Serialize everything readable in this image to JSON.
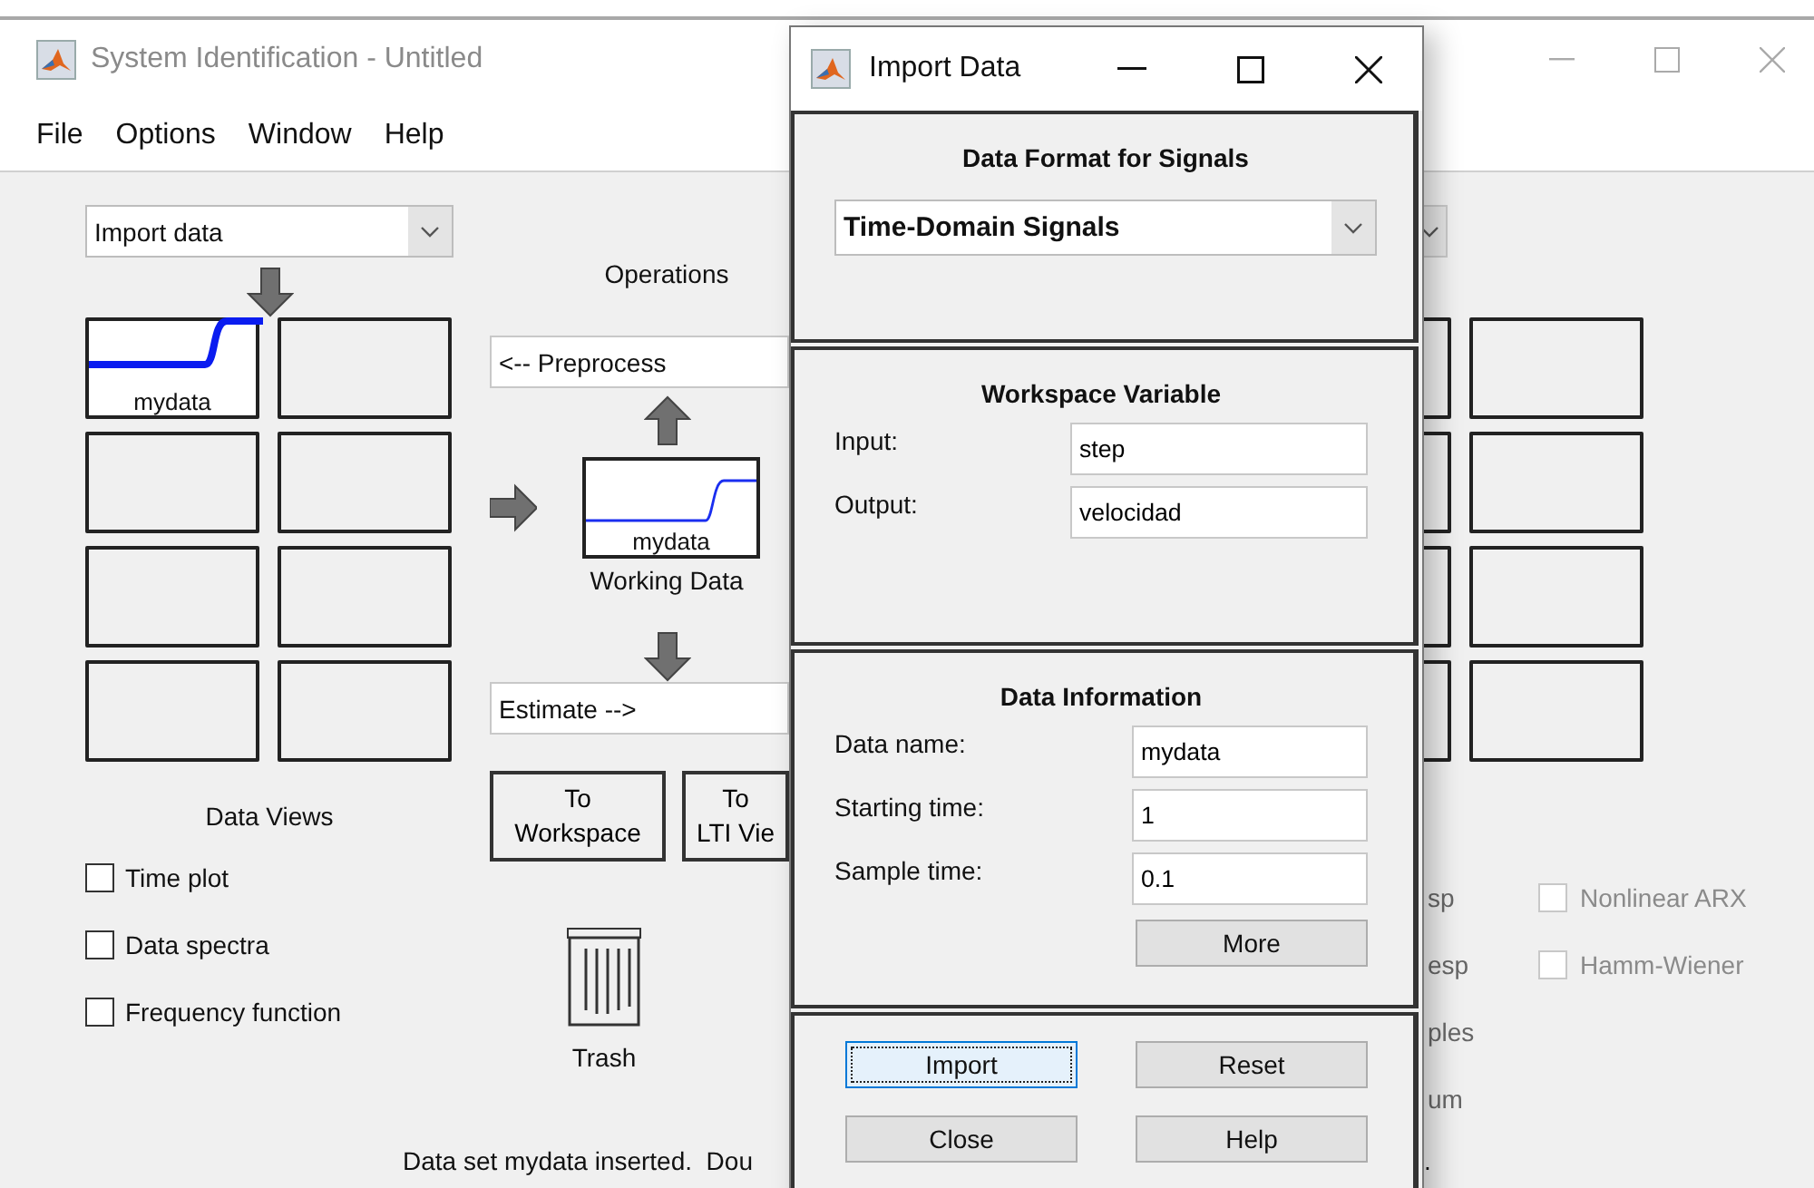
{
  "main_window": {
    "title": "System Identification - Untitled",
    "menu": [
      "File",
      "Options",
      "Window",
      "Help"
    ],
    "import_dropdown": {
      "value": "Import data"
    },
    "data_boards": [
      {
        "kind": "data",
        "label": "mydata"
      },
      {
        "kind": "empty"
      },
      {
        "kind": "empty"
      },
      {
        "kind": "empty"
      },
      {
        "kind": "empty"
      },
      {
        "kind": "empty"
      },
      {
        "kind": "empty"
      },
      {
        "kind": "empty"
      }
    ],
    "data_views": {
      "title": "Data Views",
      "options": [
        {
          "label": "Time plot",
          "checked": false
        },
        {
          "label": "Data spectra",
          "checked": false
        },
        {
          "label": "Frequency function",
          "checked": false
        }
      ]
    },
    "operations_label": "Operations",
    "preprocess": {
      "value": "<-- Preprocess"
    },
    "working_data": {
      "label": "mydata",
      "caption": "Working Data"
    },
    "estimate": {
      "value": "Estimate -->"
    },
    "buttons": [
      {
        "lines": [
          "To",
          "Workspace"
        ]
      },
      {
        "lines": [
          "To",
          "LTI Vie"
        ]
      }
    ],
    "trash_label": "Trash",
    "status": "Data set mydata inserted.  Dou",
    "status_tail": ".",
    "model_boards": [
      {
        "kind": "empty"
      },
      {
        "kind": "empty"
      },
      {
        "kind": "empty"
      },
      {
        "kind": "empty"
      },
      {
        "kind": "empty"
      },
      {
        "kind": "empty"
      },
      {
        "kind": "empty"
      },
      {
        "kind": "empty"
      }
    ],
    "model_view_fragments": [
      "sp",
      "esp",
      "ples",
      "um"
    ],
    "model_options": [
      {
        "label": "Nonlinear ARX",
        "checked": false,
        "disabled": true
      },
      {
        "label": "Hamm-Wiener",
        "checked": false,
        "disabled": true
      }
    ]
  },
  "dialog": {
    "title": "Import Data",
    "format": {
      "title": "Data Format for Signals",
      "value": "Time-Domain Signals"
    },
    "workspace": {
      "title": "Workspace Variable",
      "fields": [
        {
          "label": "Input:",
          "value": "step"
        },
        {
          "label": "Output:",
          "value": "velocidad"
        }
      ]
    },
    "info": {
      "title": "Data Information",
      "fields": [
        {
          "label": "Data name:",
          "value": "mydata"
        },
        {
          "label": "Starting time:",
          "value": "1"
        },
        {
          "label": "Sample time:",
          "value": "0.1"
        }
      ],
      "more_button": "More"
    },
    "buttons": [
      {
        "label": "Import",
        "focused": true
      },
      {
        "label": "Reset",
        "focused": false
      },
      {
        "label": "Close",
        "focused": false
      },
      {
        "label": "Help",
        "focused": false
      }
    ]
  }
}
